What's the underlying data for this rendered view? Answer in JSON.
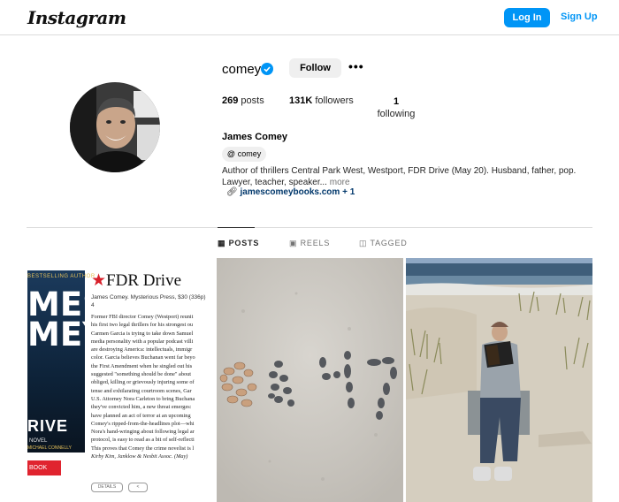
{
  "topbar": {
    "logo": "Instagram",
    "login_label": "Log In",
    "signup_label": "Sign Up"
  },
  "profile": {
    "username": "comey",
    "follow_label": "Follow",
    "more_label": "•••",
    "stats": [
      {
        "count": "269",
        "label": "posts"
      },
      {
        "count": "131K",
        "label": "followers"
      },
      {
        "count": "1",
        "label": "following"
      }
    ],
    "full_name": "James Comey",
    "threads_handle": "comey",
    "bio": "Author of thrillers Central Park West, Westport, FDR Drive (May 20). Husband, father, pop. Lawyer, teacher, speaker...",
    "bio_more": "more",
    "link": "jamescomeybooks.com + 1"
  },
  "tabs": [
    {
      "label": "POSTS",
      "icon": "grid-icon"
    },
    {
      "label": "REELS",
      "icon": "reels-icon"
    },
    {
      "label": "TAGGED",
      "icon": "tagged-icon"
    }
  ],
  "posts": {
    "post1": {
      "cover_top": "BESTSELLING AUTHOR",
      "cover_name": "MES\nMEY",
      "cover_title": "RIVE",
      "cover_novel": "NOVEL",
      "cover_author": "MICHAEL CONNELLY",
      "book_button": "BOOK",
      "review_title": "FDR Drive",
      "review_meta_1": "James Comey. Mysterious Press, $30 (336p)",
      "review_meta_2": "4",
      "review_lines": [
        "Former FBI director Comey (Westport) reunit",
        "his first two legal thrillers for his strongest ou",
        "Carmen Garcia is trying to take down Samuel",
        "media personality with a popular podcast villi",
        "are destroying America: intellectuals, immigr",
        "color. Garcia believes Buchanan went far beyo",
        "the First Amendment when he singled out his",
        "suggested \"something should be done\" about",
        "obliged, killing or grievously injuring some of",
        "tense and exhilarating courtroom scenes, Gar",
        "U.S. Attorney Nora Carleton to bring Buchana",
        "they've convicted him, a new threat emerges:",
        "have planned an act of terror at an upcoming",
        "Comey's ripped-from-the-headlines plot—whi",
        "Nora's hand-wringing about following legal ar",
        "protocol, is easy to read as a bit of self-reflecti",
        "This proves that Comey the crime novelist is l",
        "Kirby Kim, Janklow & Nesbit Assoc. (May)"
      ],
      "details_label": "DETAILS"
    }
  },
  "colors": {
    "accent": "#0095f6",
    "verified": "#0095f6",
    "book_red": "#e0242f"
  }
}
